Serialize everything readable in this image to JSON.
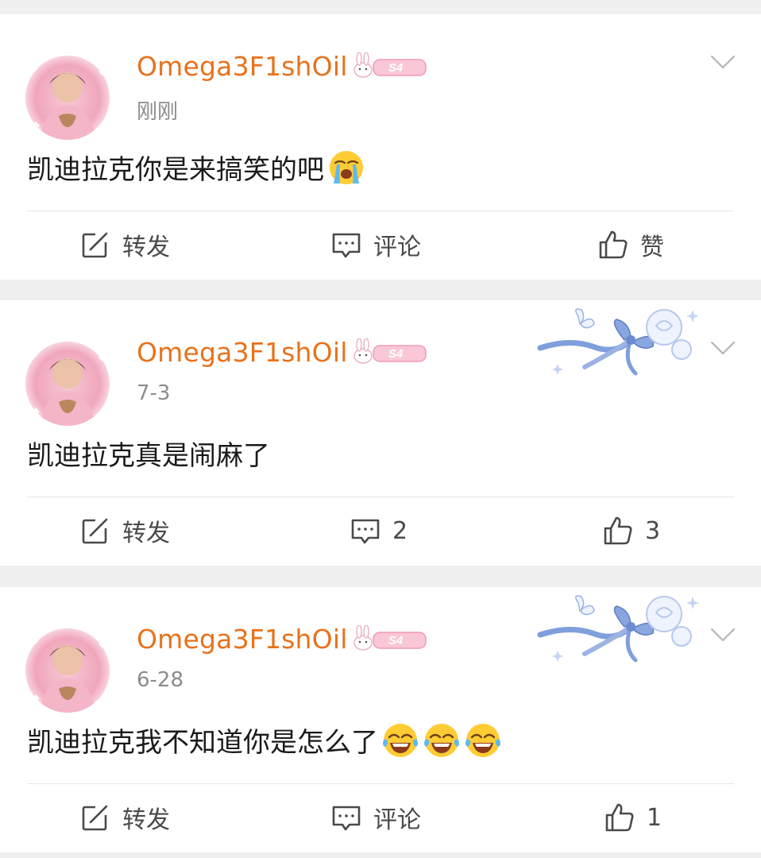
{
  "posts": [
    {
      "username": "Omega3F1shOil",
      "badge_text": "S4",
      "timestamp": "刚刚",
      "text": "凯迪拉克你是来搞笑的吧",
      "emojis": [
        "loudly-crying-emoji"
      ],
      "has_decoration": false,
      "actions": {
        "repost": "转发",
        "comment": "评论",
        "like": "赞"
      }
    },
    {
      "username": "Omega3F1shOil",
      "badge_text": "S4",
      "timestamp": "7-3",
      "text": "凯迪拉克真是闹麻了",
      "emojis": [],
      "has_decoration": true,
      "actions": {
        "repost": "转发",
        "comment": "2",
        "like": "3"
      }
    },
    {
      "username": "Omega3F1shOil",
      "badge_text": "S4",
      "timestamp": "6-28",
      "text": "凯迪拉克我不知道你是怎么了",
      "emojis": [
        "tears-of-joy-emoji",
        "tears-of-joy-emoji",
        "tears-of-joy-emoji"
      ],
      "has_decoration": true,
      "actions": {
        "repost": "转发",
        "comment": "评论",
        "like": "1"
      }
    }
  ],
  "colors": {
    "username": "#e8721c",
    "timestamp": "#8c8c8c",
    "text": "#1a1a1a",
    "action": "#4a4a4a",
    "badge": "#f4a7bd",
    "decoration_blue": "#7f9fdc",
    "page_bg": "#f0f0f0"
  }
}
